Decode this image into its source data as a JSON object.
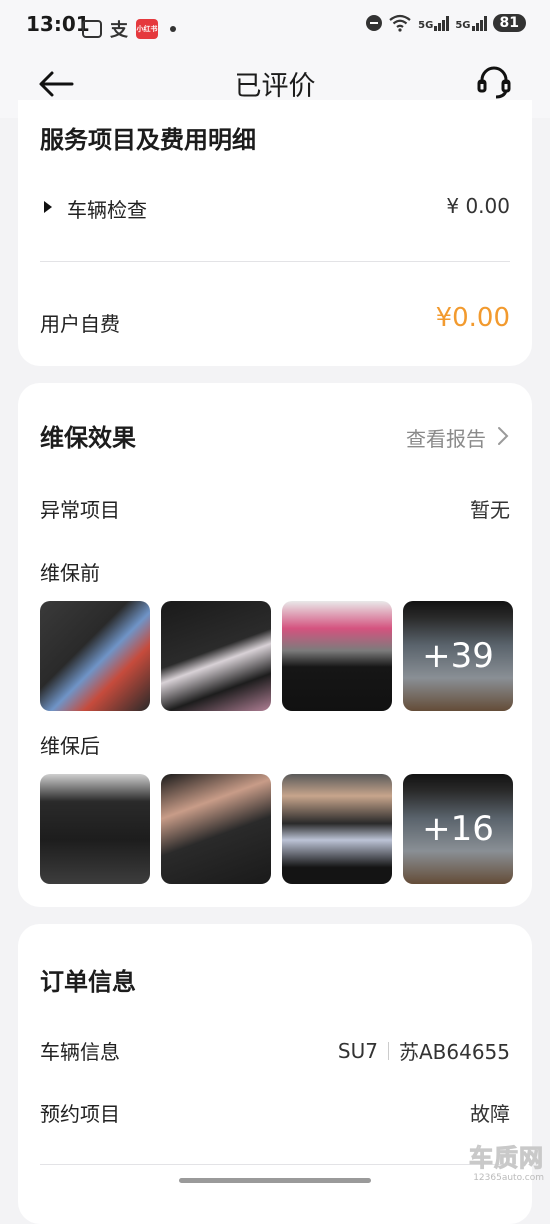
{
  "status_bar": {
    "time": "13:01",
    "zhi": "支",
    "red_badge": "小红书",
    "battery": "81",
    "network": "5G"
  },
  "nav": {
    "title": "已评价"
  },
  "services": {
    "title": "服务项目及费用明细",
    "item_label": "车辆检查",
    "item_price": "¥ 0.00",
    "user_fee_label": "用户自费",
    "user_fee_value": "¥0.00"
  },
  "maintenance": {
    "title": "维保效果",
    "report_link": "查看报告",
    "abnormal_label": "异常项目",
    "abnormal_value": "暂无",
    "before_label": "维保前",
    "before_more": "+39",
    "after_label": "维保后",
    "after_more": "+16"
  },
  "order": {
    "title": "订单信息",
    "vehicle_label": "车辆信息",
    "vehicle_model": "SU7",
    "vehicle_plate": "苏AB64655",
    "appointment_label": "预约项目",
    "appointment_value": "故障"
  },
  "watermark": {
    "main": "车质网",
    "sub": "12365auto.com"
  },
  "colors": {
    "accent_orange": "#f29a2e",
    "background": "#f3f3f5",
    "card": "#ffffff"
  }
}
